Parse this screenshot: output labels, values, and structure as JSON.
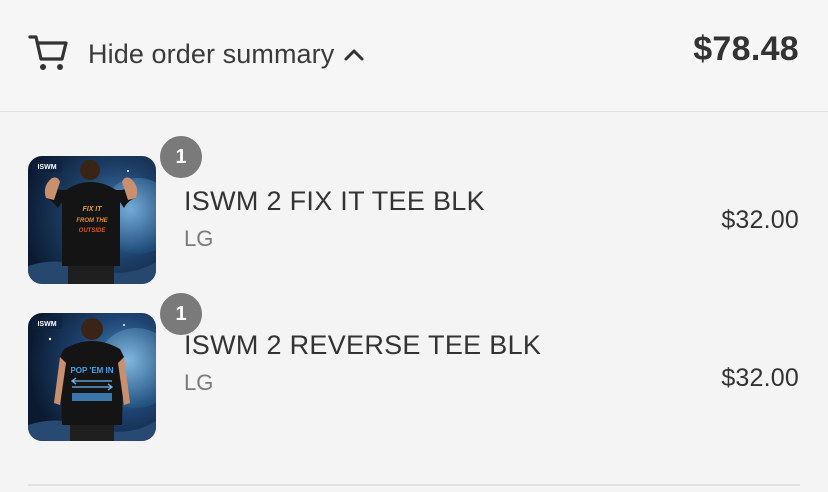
{
  "header": {
    "toggle_label": "Hide order summary",
    "total": "$78.48",
    "cart_icon": "cart-icon",
    "chevron_icon": "chevron-up-icon"
  },
  "items": [
    {
      "quantity": "1",
      "name": "ISWM 2 FIX IT TEE BLK",
      "variant": "LG",
      "price": "$32.00",
      "thumbnail_print": "FIX IT FROM THE OUTSIDE",
      "thumbnail_logo": "ISWM"
    },
    {
      "quantity": "1",
      "name": "ISWM 2 REVERSE TEE BLK",
      "variant": "LG",
      "price": "$32.00",
      "thumbnail_print": "POP 'EM IN",
      "thumbnail_logo": "ISWM"
    }
  ],
  "colors": {
    "background": "#f4f4f4",
    "text": "#333333",
    "muted": "#7a7a7a",
    "badge": "#7a7a7a",
    "divider": "#e1e1e1"
  }
}
